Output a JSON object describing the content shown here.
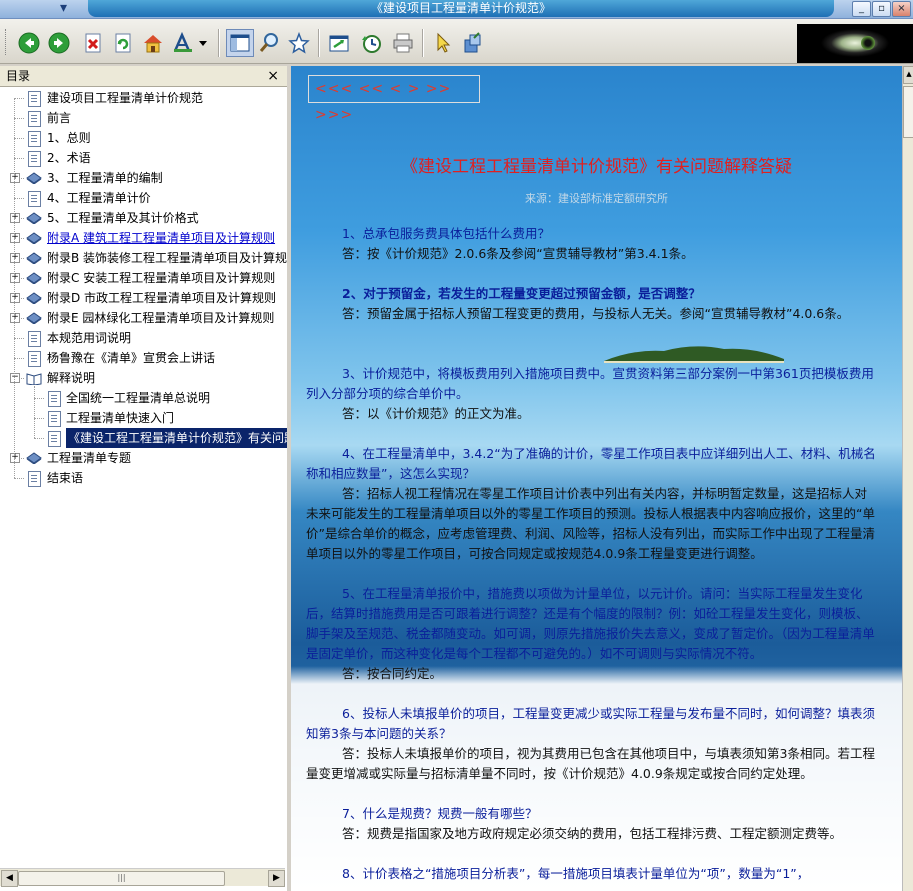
{
  "window": {
    "title": "《建设项目工程量清单计价规范》",
    "buttons": [
      "_",
      "▫",
      "×"
    ]
  },
  "toolbar": {
    "icons": [
      "back-icon",
      "forward-icon",
      "stop-icon",
      "refresh-icon",
      "home-icon",
      "font-icon",
      "dropdown-icon",
      "toc-icon",
      "search-icon",
      "favorites-icon",
      "sync-icon",
      "history-icon",
      "print-icon",
      "pointer-icon",
      "options-icon"
    ]
  },
  "sidebar": {
    "title": "目录",
    "close": "×",
    "items": [
      {
        "label": "建设项目工程量清单计价规范",
        "level": 0,
        "type": "page",
        "expander": ""
      },
      {
        "label": "前言",
        "level": 0,
        "type": "page",
        "expander": ""
      },
      {
        "label": "1、总则",
        "level": 0,
        "type": "page",
        "expander": ""
      },
      {
        "label": "2、术语",
        "level": 0,
        "type": "page",
        "expander": ""
      },
      {
        "label": "3、工程量清单的编制",
        "level": 0,
        "type": "book",
        "expander": "+"
      },
      {
        "label": "4、工程量清单计价",
        "level": 0,
        "type": "page",
        "expander": ""
      },
      {
        "label": "5、工程量清单及其计价格式",
        "level": 0,
        "type": "book",
        "expander": "+"
      },
      {
        "label": "附录A 建筑工程工程量清单项目及计算规则",
        "level": 0,
        "type": "book",
        "expander": "+",
        "style": "link"
      },
      {
        "label": "附录B 装饰装修工程工程量清单项目及计算规则",
        "level": 0,
        "type": "book",
        "expander": "+"
      },
      {
        "label": "附录C 安装工程工程量清单项目及计算规则",
        "level": 0,
        "type": "book",
        "expander": "+"
      },
      {
        "label": "附录D 市政工程工程量清单项目及计算规则",
        "level": 0,
        "type": "book",
        "expander": "+"
      },
      {
        "label": "附录E 园林绿化工程量清单项目及计算规则",
        "level": 0,
        "type": "book",
        "expander": "+"
      },
      {
        "label": "本规范用词说明",
        "level": 0,
        "type": "page",
        "expander": ""
      },
      {
        "label": "杨鲁豫在《清单》宣贯会上讲话",
        "level": 0,
        "type": "page",
        "expander": ""
      },
      {
        "label": "解释说明",
        "level": 0,
        "type": "open",
        "expander": "−"
      },
      {
        "label": "全国统一工程量清单总说明",
        "level": 1,
        "type": "page",
        "expander": ""
      },
      {
        "label": "工程量清单快速入门",
        "level": 1,
        "type": "page",
        "expander": ""
      },
      {
        "label": "《建设工程工程量清单计价规范》有关问题",
        "level": 1,
        "type": "page",
        "expander": "",
        "style": "selected"
      },
      {
        "label": "工程量清单专题",
        "level": 0,
        "type": "book",
        "expander": "+"
      },
      {
        "label": "结束语",
        "level": 0,
        "type": "page",
        "expander": ""
      }
    ]
  },
  "content": {
    "nav": "<<< << <  > >> >>>",
    "title": "《建设工程工程量清单计价规范》有关问题解释答疑",
    "source": "来源：建设部标准定额研究所",
    "qa": [
      {
        "q": "1、总承包服务费具体包括什么费用？",
        "a": "答：按《计价规范》2.0.6条及参阅“宣贯辅导教材”第3.4.1条。",
        "qbold": false
      },
      {
        "q": "2、对于预留金，若发生的工程量变更超过预留金额，是否调整？",
        "a": "答：预留金属于招标人预留工程变更的费用，与投标人无关。参阅“宣贯辅导教材”4.0.6条。",
        "qbold": true
      },
      {
        "q": "3、计价规范中，将模板费用列入措施项目费中。宣贯资料第三部分案例一中第361页把模板费用列入分部分项的综合单价中。",
        "a": "答：以《计价规范》的正文为准。",
        "qbold": false
      },
      {
        "q": "4、在工程量清单中，3.4.2“为了准确的计价，零星工作项目表中应详细列出人工、材料、机械名称和相应数量”，这怎么实现？",
        "a": "答：招标人视工程情况在零星工作项目计价表中列出有关内容，并标明暂定数量，这是招标人对未来可能发生的工程量清单项目以外的零星工作项目的预测。投标人根据表中内容响应报价，这里的“单价”是综合单价的概念，应考虑管理费、利润、风险等，招标人没有列出，而实际工作中出现了工程量清单项目以外的零星工作项目，可按合同规定或按规范4.0.9条工程量变更进行调整。",
        "qbold": false
      },
      {
        "q": "5、在工程量清单报价中，措施费以项做为计量单位，以元计价。请问：当实际工程量发生变化后，结算时措施费用是否可跟着进行调整？还是有个幅度的限制？例：如砼工程量发生变化，则模板、脚手架及至规范、税金都随变动。如可调，则原先措施报价失去意义，变成了暂定价。（因为工程量清单是固定单价，而这种变化是每个工程都不可避免的。）如不可调则与实际情况不符。",
        "a": "答：按合同约定。",
        "qbold": false
      },
      {
        "q": "6、投标人未填报单价的项目，工程量变更减少或实际工程量与发布量不同时，如何调整？填表须知第3条与本问题的关系？",
        "a": "答：投标人未填报单价的项目，视为其费用已包含在其他项目中，与填表须知第3条相同。若工程量变更增减或实际量与招标清单量不同时，按《计价规范》4.0.9条规定或按合同约定处理。",
        "qbold": false
      },
      {
        "q": "7、什么是规费？规费一般有哪些？",
        "a": "答：规费是指国家及地方政府规定必须交纳的费用，包括工程排污费、工程定额测定费等。",
        "qbold": false
      },
      {
        "q": "8、计价表格之“措施项目分析表”，每一措施项目填表计量单位为“项”，数量为“1”，",
        "a": "",
        "qbold": false
      }
    ]
  },
  "colors": {
    "accent": "#1e6fb5",
    "title_red": "#e02020",
    "question_blue": "#0a1e9a",
    "selected_bg": "#0a246a"
  }
}
